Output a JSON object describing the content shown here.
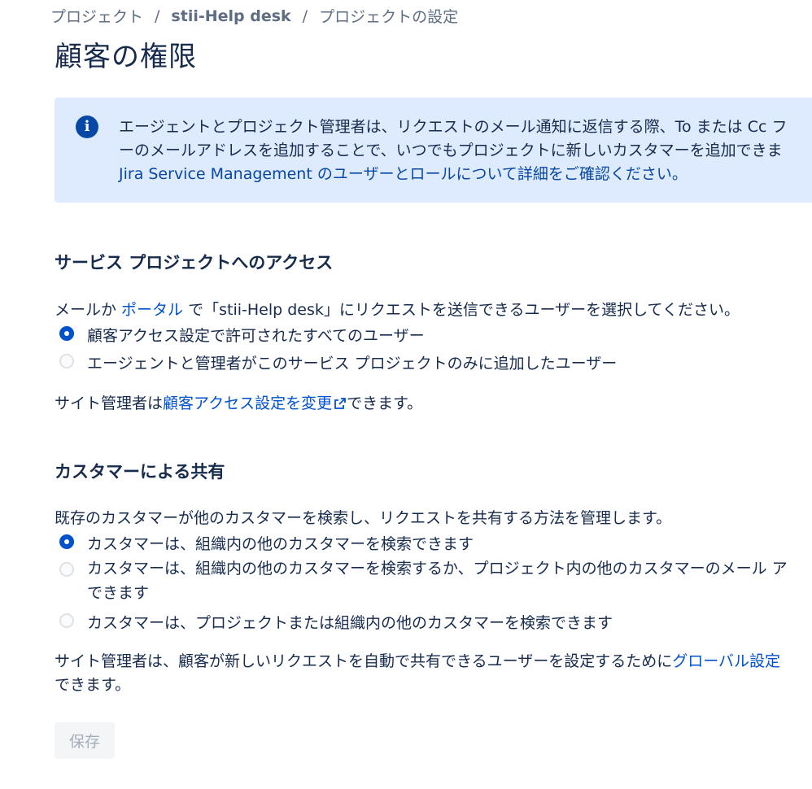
{
  "breadcrumb": {
    "items": [
      "プロジェクト",
      "stii-Help desk",
      "プロジェクトの設定"
    ],
    "separator": "/"
  },
  "page": {
    "title": "顧客の権限"
  },
  "info_panel": {
    "line1": "エージェントとプロジェクト管理者は、リクエストのメール通知に返信する際、To または Cc フ",
    "line2": "ーのメールアドレスを追加することで、いつでもプロジェクトに新しいカスタマーを追加できま",
    "link": "Jira Service Management のユーザーとロールについて詳細をご確認ください。"
  },
  "access_section": {
    "heading": "サービス プロジェクトへのアクセス",
    "desc_prefix": "メールか ",
    "desc_link": "ポータル",
    "desc_suffix": " で「stii-Help desk」にリクエストを送信できるユーザーを選択してください。",
    "options": [
      {
        "label": "顧客アクセス設定で許可されたすべてのユーザー",
        "selected": true
      },
      {
        "label": "エージェントと管理者がこのサービス プロジェクトのみに追加したユーザー",
        "selected": false
      }
    ],
    "note_prefix": "サイト管理者は",
    "note_link": "顧客アクセス設定を変更",
    "note_suffix": "できます。",
    "note_link_icon": "external-link-icon"
  },
  "sharing_section": {
    "heading": "カスタマーによる共有",
    "desc": "既存のカスタマーが他のカスタマーを検索し、リクエストを共有する方法を管理します。",
    "options": [
      {
        "label": "カスタマーは、組織内の他のカスタマーを検索できます",
        "selected": true
      },
      {
        "label_line1": "カスタマーは、組織内の他のカスタマーを検索するか、プロジェクト内の他のカスタマーのメール ア",
        "label_line2": "できます",
        "selected": false
      },
      {
        "label": "カスタマーは、プロジェクトまたは組織内の他のカスタマーを検索できます",
        "selected": false
      }
    ],
    "note_prefix": "サイト管理者は、顧客が新しいリクエストを自動で共有できるユーザーを設定するために",
    "note_link": "グローバル設定",
    "note_line2": "できます。"
  },
  "actions": {
    "save_label": "保存",
    "save_disabled": true
  },
  "colors": {
    "link": "#0052CC",
    "info_background": "#DEEBFF",
    "info_icon": "#0747A6",
    "text": "#172B4D",
    "muted": "#5E6C84",
    "radio_checked": "#0052CC",
    "button_disabled_bg": "#F4F5F7",
    "button_disabled_text": "#A5ADBA"
  }
}
